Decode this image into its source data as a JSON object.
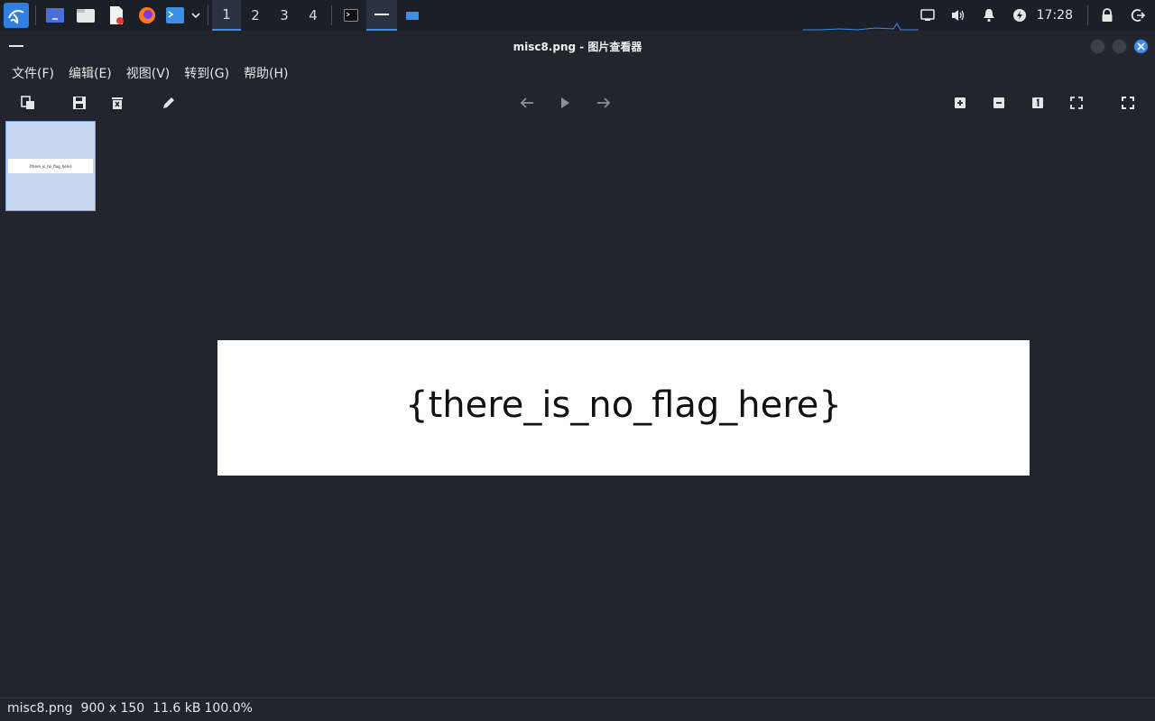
{
  "taskbar": {
    "workspaces": [
      "1",
      "2",
      "3",
      "4"
    ],
    "active_workspace": "1",
    "clock": "17:28"
  },
  "window": {
    "title": "misc8.png - 图片查看器"
  },
  "menu": {
    "file": "文件(F)",
    "edit": "编辑(E)",
    "view": "视图(V)",
    "goto": "转到(G)",
    "help": "帮助(H)"
  },
  "thumbnail": {
    "text": "{there_is_no_flag_here}"
  },
  "image": {
    "text": "{there_is_no_flag_here}"
  },
  "status": {
    "filename": "misc8.png",
    "dimensions": "900 x 150",
    "size": "11.6 kB",
    "zoom": "100.0%"
  },
  "colors": {
    "accent": "#3d8ee6",
    "background": "#22252e",
    "panel": "#1b1f27"
  }
}
